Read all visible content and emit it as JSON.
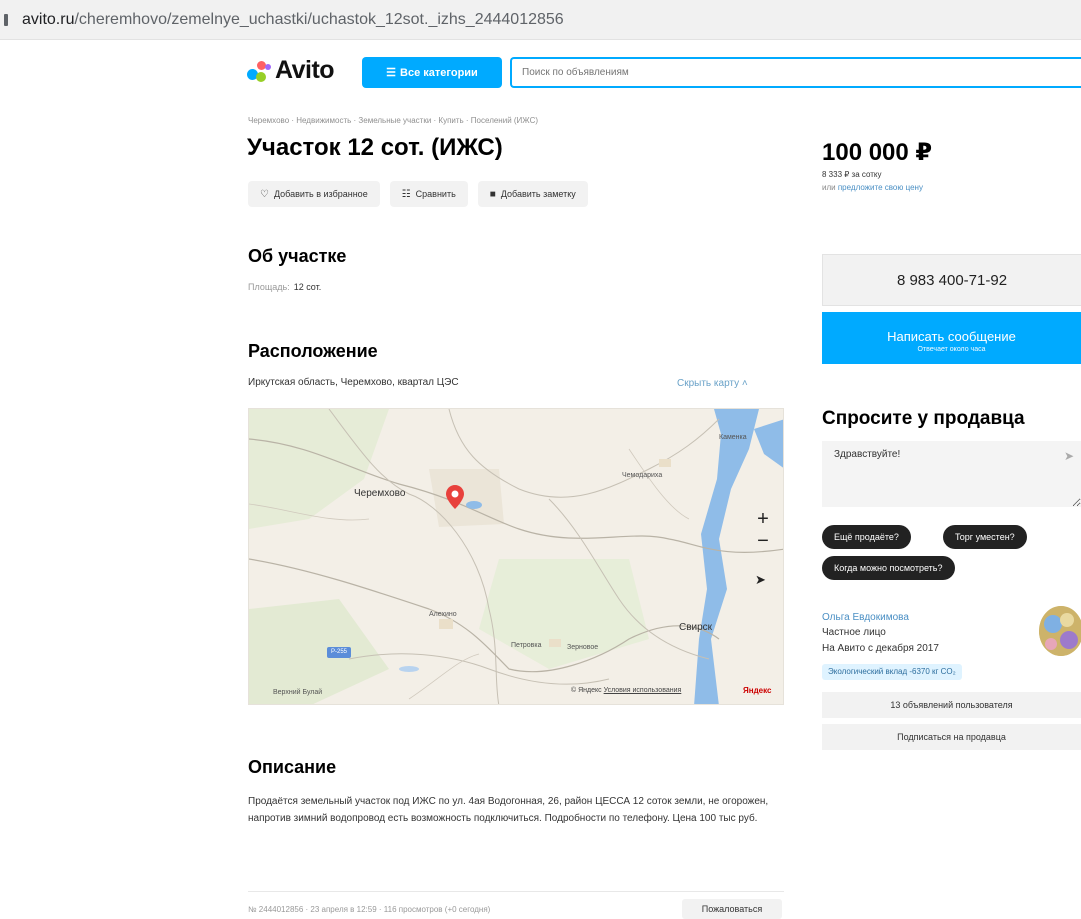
{
  "browser": {
    "url_domain": "avito.ru",
    "url_path": "/cheremhovo/zemelnye_uchastki/uchastok_12sot._izhs_2444012856"
  },
  "header": {
    "logo_text": "Avito",
    "categories_button": "Все категории",
    "search_placeholder": "Поиск по объявлениям"
  },
  "listing": {
    "breadcrumbs": "Черемхово · Недвижимость · Земельные участки · Купить · Поселений (ИЖС)",
    "title": "Участок 12 сот. (ИЖС)",
    "actions": {
      "favorite": "Добавить в избранное",
      "compare": "Сравнить",
      "note": "Добавить заметку"
    },
    "about": {
      "heading": "Об участке",
      "area_label": "Площадь:",
      "area_value": "12 сот."
    },
    "location": {
      "heading": "Расположение",
      "address": "Иркутская область, Черемхово, квартал ЦЭС",
      "hide_map": "Скрыть карту ˄"
    },
    "map": {
      "labels": {
        "cheremkhovo": "Черемхово",
        "kamenka": "Каменка",
        "chemodariha": "Чемодариха",
        "aleksino": "Алехино",
        "svirsk": "Свирск",
        "petrovka": "Петровка",
        "zernovoe": "Зерновое",
        "verkhniy_bulay": "Верхний Булай",
        "road_sign": "Р-255"
      },
      "zoom_in": "+",
      "zoom_out": "−",
      "copyright_prefix": "© Яндекс",
      "terms": "Условия использования",
      "yandex": "Яндекс"
    },
    "description": {
      "heading": "Описание",
      "text": "Продаётся земельный участок под ИЖС по ул. 4ая Водогонная, 26, район ЦЕССА 12 соток земли, не огорожен, напротив зимний водопровод есть возможность подключиться. Подробности по телефону. Цена 100 тыс руб."
    },
    "meta": "№ 2444012856 · 23 апреля в 12:59 · 116 просмотров (+0 сегодня)",
    "complain": "Пожаловаться"
  },
  "sidebar": {
    "price": "100 000 ₽",
    "price_per_unit": "8 333 ₽ за сотку",
    "offer_prefix": "или",
    "offer_link": "предложите свою цену",
    "phone": "8 983 400-71-92",
    "message_button": "Написать сообщение",
    "message_sub": "Отвечает около часа",
    "ask_heading": "Спросите у продавца",
    "ask_value": "Здравствуйте!",
    "chips": [
      "Ещё продаёте?",
      "Торг уместен?",
      "Когда можно посмотреть?"
    ],
    "seller": {
      "name": "Ольга Евдокимова",
      "type": "Частное лицо",
      "since": "На Авито с декабря 2017",
      "eco": "Экологический вклад -6370 кг CO₂"
    },
    "user_ads": "13 объявлений пользователя",
    "subscribe": "Подписаться на продавца"
  },
  "colors": {
    "accent": "#00aaff",
    "link": "#4a8fc4",
    "river": "#7fb0e3",
    "pin": "#e8413c"
  }
}
